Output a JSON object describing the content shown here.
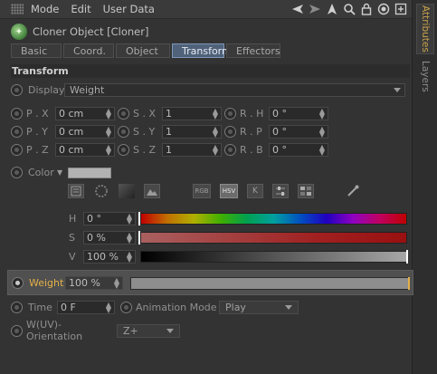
{
  "menu": {
    "items": [
      {
        "label": "Mode"
      },
      {
        "label": "Edit"
      },
      {
        "label": "User Data"
      }
    ]
  },
  "side_tabs": {
    "attributes": "Attributes",
    "layers": "Layers"
  },
  "object": {
    "title": "Cloner Object [Cloner]"
  },
  "tabs": [
    {
      "label": "Basic",
      "active": false
    },
    {
      "label": "Coord.",
      "active": false
    },
    {
      "label": "Object",
      "active": false
    },
    {
      "label": "Transform",
      "active": true
    },
    {
      "label": "Effectors",
      "active": false
    }
  ],
  "section": {
    "title": "Transform"
  },
  "display": {
    "label": "Display",
    "value": "Weight"
  },
  "position": {
    "x_label": "P . X",
    "x_value": "0 cm",
    "y_label": "P . Y",
    "y_value": "0 cm",
    "z_label": "P . Z",
    "z_value": "0 cm"
  },
  "scale": {
    "x_label": "S . X",
    "x_value": "1",
    "y_label": "S . Y",
    "y_value": "1",
    "z_label": "S . Z",
    "z_value": "1"
  },
  "rotation": {
    "h_label": "R . H",
    "h_value": "0 °",
    "p_label": "R . P",
    "p_value": "0 °",
    "b_label": "R . B",
    "b_value": "0 °"
  },
  "color": {
    "label": "Color",
    "swatch": "#b2b2b2",
    "tools": [
      "RGB",
      "HSV",
      "K"
    ]
  },
  "hsv": {
    "h_label": "H",
    "h_value": "0 °",
    "s_label": "S",
    "s_value": "0 %",
    "v_label": "V",
    "v_value": "100 %"
  },
  "weight": {
    "label": "Weight",
    "value": "100 %",
    "fraction": 1.0
  },
  "time": {
    "label": "Time",
    "value": "0 F"
  },
  "animation_mode": {
    "label": "Animation Mode",
    "value": "Play"
  },
  "orientation": {
    "label": "W(UV)-Orientation",
    "value": "Z+"
  },
  "colors": {
    "accent": "#e4b048",
    "active_tab": "#50627a"
  }
}
